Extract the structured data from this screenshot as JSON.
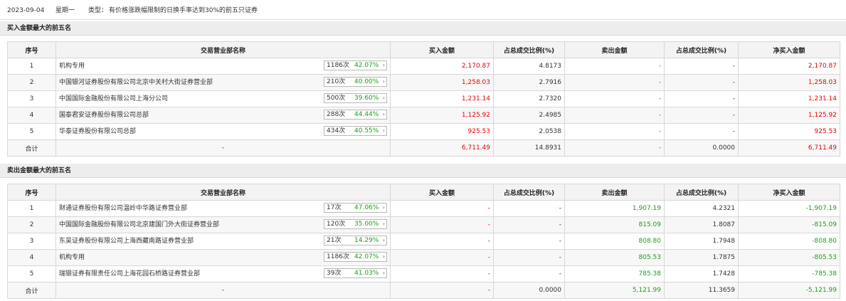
{
  "header": {
    "date": "2023-09-04",
    "weekday": "星期一",
    "type_label": "类型：",
    "type_value": "有价格涨跌幅限制的日换手率达到30%的前五只证券"
  },
  "colors": {
    "up": "#e60000",
    "down": "#1f9c1f"
  },
  "icons": {
    "badge_arrow": "chevron-right-icon"
  },
  "columns": [
    "序号",
    "交易营业部名称",
    "买入金额",
    "占总成交比例(%)",
    "卖出金额",
    "占总成交比例(%)",
    "净买入金额"
  ],
  "buy": {
    "title": "买入金额最大的前五名",
    "rows": [
      {
        "idx": "1",
        "name": "机构专用",
        "count": "1186次",
        "pct": "42.07%",
        "buy": "2,170.87",
        "buy_ratio": "4.8173",
        "sell": "-",
        "sell_ratio": "-",
        "net": "2,170.87"
      },
      {
        "idx": "2",
        "name": "中国银河证券股份有限公司北京中关村大街证券营业部",
        "count": "210次",
        "pct": "40.00%",
        "buy": "1,258.03",
        "buy_ratio": "2.7916",
        "sell": "-",
        "sell_ratio": "-",
        "net": "1,258.03"
      },
      {
        "idx": "3",
        "name": "中国国际金融股份有限公司上海分公司",
        "count": "500次",
        "pct": "39.60%",
        "buy": "1,231.14",
        "buy_ratio": "2.7320",
        "sell": "-",
        "sell_ratio": "-",
        "net": "1,231.14"
      },
      {
        "idx": "4",
        "name": "国泰君安证券股份有限公司总部",
        "count": "288次",
        "pct": "44.44%",
        "buy": "1,125.92",
        "buy_ratio": "2.4985",
        "sell": "-",
        "sell_ratio": "-",
        "net": "1,125.92"
      },
      {
        "idx": "5",
        "name": "华泰证券股份有限公司总部",
        "count": "434次",
        "pct": "40.55%",
        "buy": "925.53",
        "buy_ratio": "2.0538",
        "sell": "-",
        "sell_ratio": "-",
        "net": "925.53"
      }
    ],
    "total": {
      "label": "合计",
      "name": "-",
      "buy": "6,711.49",
      "buy_ratio": "14.8931",
      "sell": "-",
      "sell_ratio": "0.0000",
      "net": "6,711.49"
    }
  },
  "sell": {
    "title": "卖出金额最大的前五名",
    "rows": [
      {
        "idx": "1",
        "name": "财通证券股份有限公司温岭中华路证券营业部",
        "count": "17次",
        "pct": "47.06%",
        "buy": "-",
        "buy_ratio": "-",
        "sell": "1,907.19",
        "sell_ratio": "4.2321",
        "net": "-1,907.19"
      },
      {
        "idx": "2",
        "name": "中国国际金融股份有限公司北京建国门外大街证券营业部",
        "count": "120次",
        "pct": "35.00%",
        "buy": "-",
        "buy_ratio": "-",
        "sell": "815.09",
        "sell_ratio": "1.8087",
        "net": "-815.09"
      },
      {
        "idx": "3",
        "name": "东吴证券股份有限公司上海西藏南路证券营业部",
        "count": "21次",
        "pct": "14.29%",
        "buy": "-",
        "buy_ratio": "-",
        "sell": "808.80",
        "sell_ratio": "1.7948",
        "net": "-808.80"
      },
      {
        "idx": "4",
        "name": "机构专用",
        "count": "1186次",
        "pct": "42.07%",
        "buy": "-",
        "buy_ratio": "-",
        "sell": "805.53",
        "sell_ratio": "1.7875",
        "net": "-805.53"
      },
      {
        "idx": "5",
        "name": "瑞银证券有限责任公司上海花园石桥路证券营业部",
        "count": "39次",
        "pct": "41.03%",
        "buy": "-",
        "buy_ratio": "-",
        "sell": "785.38",
        "sell_ratio": "1.7428",
        "net": "-785.38"
      }
    ],
    "total": {
      "label": "合计",
      "name": "-",
      "buy": "-",
      "buy_ratio": "0.0000",
      "sell": "5,121.99",
      "sell_ratio": "11.3659",
      "net": "-5,121.99"
    }
  }
}
